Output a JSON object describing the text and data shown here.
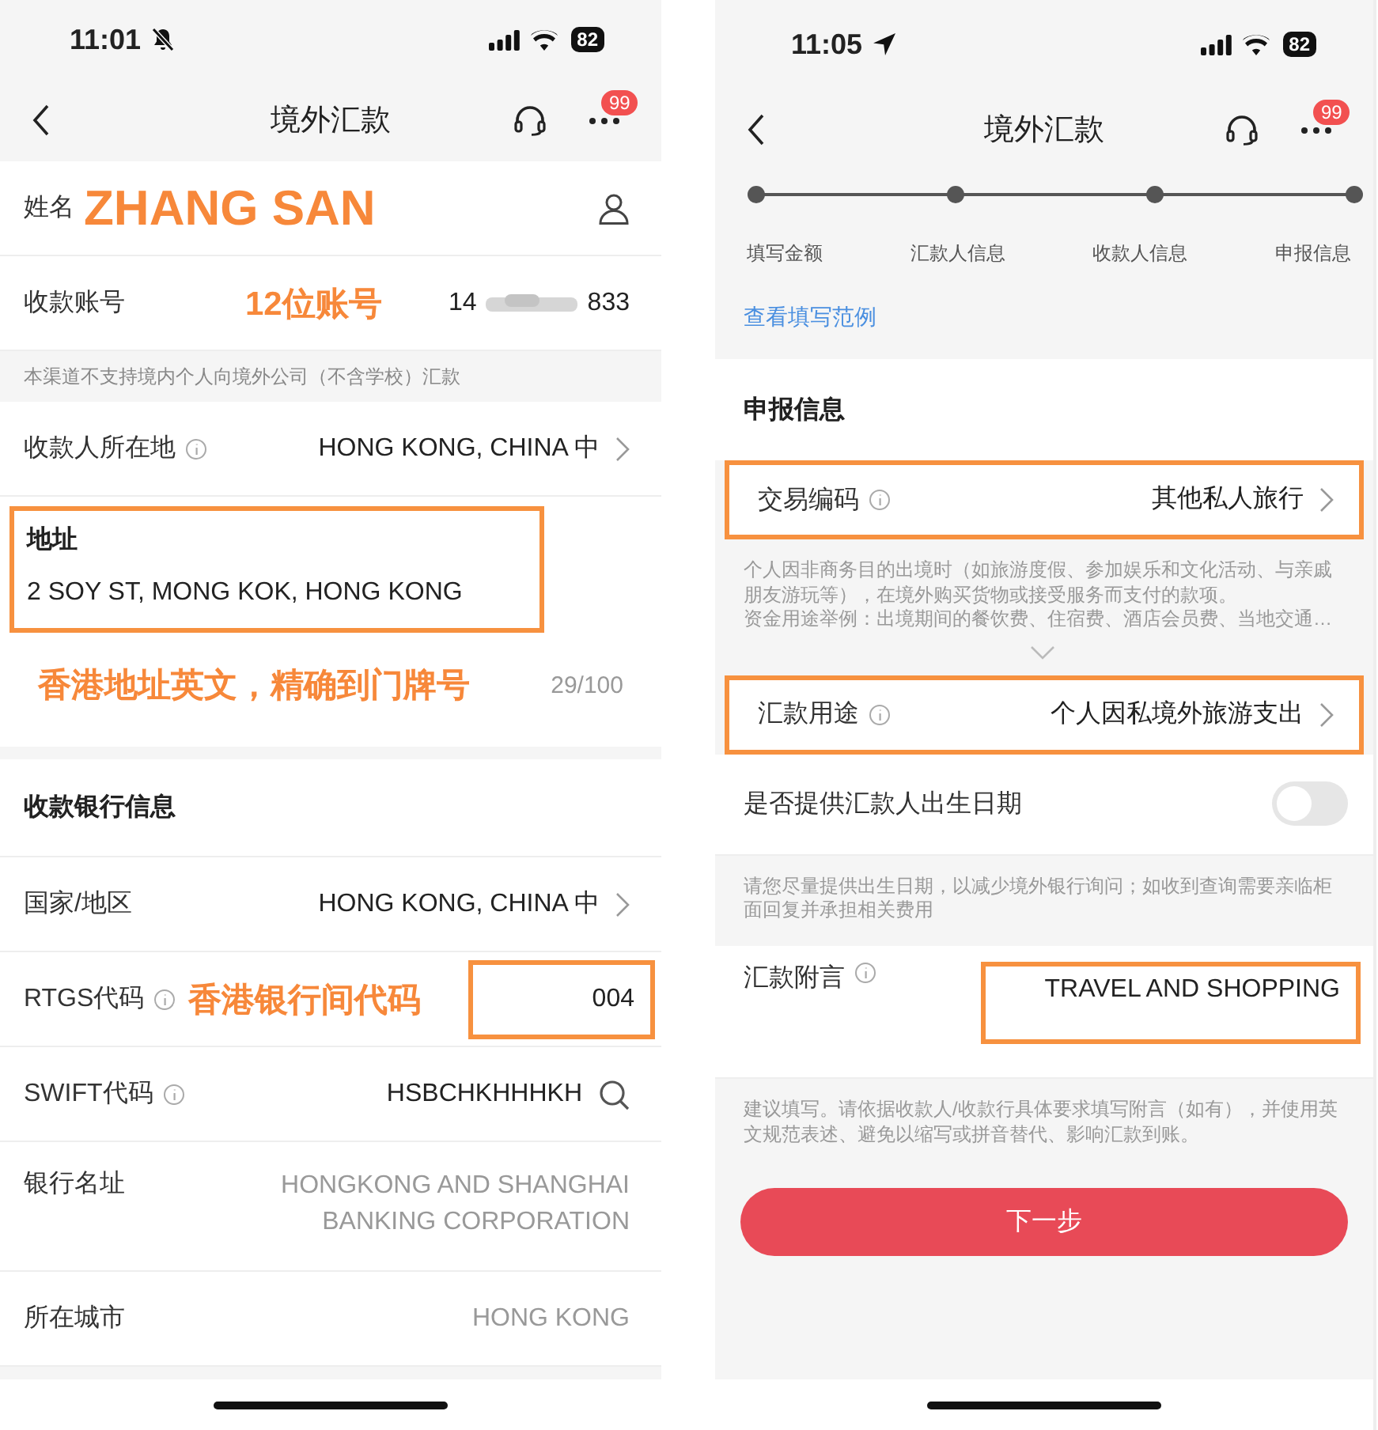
{
  "screens": [
    {
      "status_bar": {
        "time": "11:01",
        "silenced": true,
        "battery": "82"
      },
      "nav_bar": {
        "title": "境外汇款",
        "badge": "99"
      },
      "items": [
        {
          "kind": "field",
          "label": "姓名",
          "annotation": "ZHANG SAN",
          "contact_picker": true
        },
        {
          "kind": "field",
          "label": "收款账号",
          "annotation": "12位账号",
          "value": "14",
          "value_end": "833",
          "masked": true
        },
        {
          "kind": "notice",
          "text": "本渠道不支持境内个人向境外公司（不含学校）汇款"
        },
        {
          "kind": "field",
          "label": "收款人所在地",
          "info": true,
          "value": "HONG KONG, CHINA 中",
          "picker": true
        },
        {
          "kind": "textarea",
          "label": "地址",
          "value": "2 SOY ST, MONG KOK, HONG KONG",
          "highlighted": true,
          "annotation": "香港地址英文，精确到门牌号",
          "counter": "29/100"
        },
        {
          "kind": "section",
          "title": "收款银行信息"
        },
        {
          "kind": "field",
          "label": "国家/地区",
          "value": "HONG KONG, CHINA 中",
          "picker": true
        },
        {
          "kind": "field",
          "label": "RTGS代码",
          "info": true,
          "annotation": "香港银行间代码",
          "value": "004",
          "value_highlighted": true
        },
        {
          "kind": "field",
          "label": "SWIFT代码",
          "info": true,
          "value": "HSBCHKHHHKH",
          "searchable": true
        },
        {
          "kind": "field",
          "label": "银行名址",
          "value": "HONGKONG AND SHANGHAI BANKING CORPORATION",
          "readonly": true
        },
        {
          "kind": "field",
          "label": "所在城市",
          "value": "HONG KONG",
          "readonly": true
        }
      ]
    },
    {
      "status_bar": {
        "time": "11:05",
        "location": true,
        "battery": "82"
      },
      "nav_bar": {
        "title": "境外汇款",
        "badge": "99"
      },
      "steps": [
        "填写金额",
        "汇款人信息",
        "收款人信息",
        "申报信息"
      ],
      "link": "查看填写范例",
      "items": [
        {
          "kind": "section",
          "title": "申报信息"
        },
        {
          "kind": "field",
          "label": "交易编码",
          "info": true,
          "value": "其他私人旅行",
          "picker": true,
          "highlighted": true
        },
        {
          "kind": "description",
          "lines": [
            "个人因非商务目的出境时（如旅游度假、参加娱乐和文化活动、与亲戚朋友游玩等），在境外购买货物或接受服务而支付的款项。",
            "资金用途举例：出境期间的餐饮费、住宿费、酒店会员费、当地交通…"
          ],
          "expandable": true
        },
        {
          "kind": "field",
          "label": "汇款用途",
          "info": true,
          "value": "个人因私境外旅游支出",
          "picker": true,
          "highlighted": true
        },
        {
          "kind": "toggle",
          "label": "是否提供汇款人出生日期",
          "on": false
        },
        {
          "kind": "notice",
          "text": "请您尽量提供出生日期，以减少境外银行询问；如收到查询需要亲临柜面回复并承担相关费用"
        },
        {
          "kind": "field",
          "label": "汇款附言",
          "info": true,
          "value": "TRAVEL AND SHOPPING",
          "value_highlighted": true
        },
        {
          "kind": "notice",
          "text": "建议填写。请依据收款人/收款行具体要求填写附言（如有），并使用英文规范表述、避免以缩写或拼音替代、影响汇款到账。"
        }
      ],
      "button": "下一步"
    }
  ]
}
